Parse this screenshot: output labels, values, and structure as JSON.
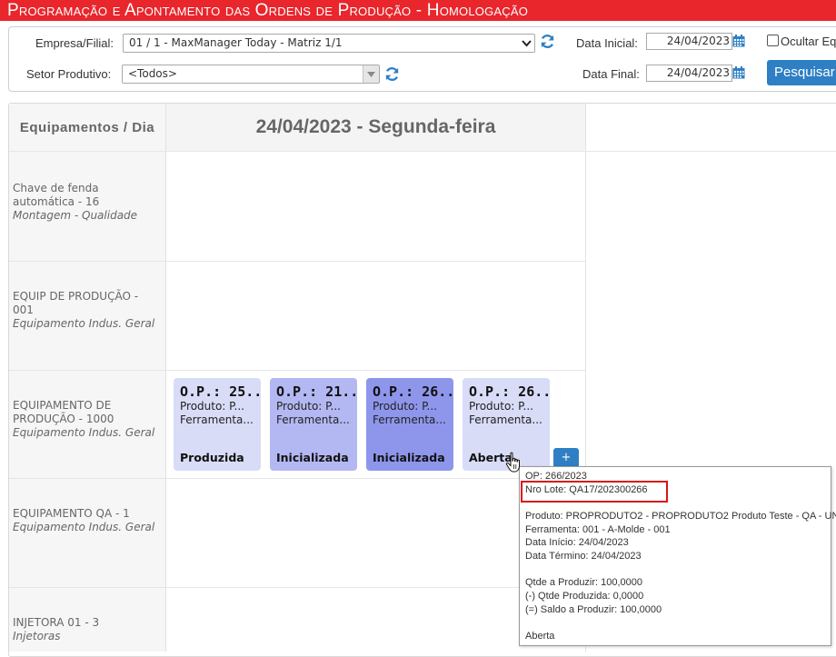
{
  "app": {
    "title": "Programação e Apontamento das Ordens de Produção  - Homologação"
  },
  "filters": {
    "empresa_label": "Empresa/Filial:",
    "empresa_value": "01 / 1 - MaxManager Today - Matriz 1/1",
    "setor_label": "Setor Produtivo:",
    "setor_value": "<Todos>",
    "data_inicial_label": "Data Inicial:",
    "data_inicial_value": "24/04/2023",
    "data_final_label": "Data Final:",
    "data_final_value": "24/04/2023",
    "ocultar_label": "Ocultar Eq",
    "pesquisar_label": "Pesquisar"
  },
  "grid": {
    "header_left": "Equipamentos / Dia",
    "header_day": "24/04/2023 - Segunda-feira",
    "equipment": [
      {
        "name": "Chave de fenda automática - 16",
        "group": "Montagem - Qualidade"
      },
      {
        "name": "EQUIP DE PRODUÇÃO - 001",
        "group": "Equipamento Indus. Geral"
      },
      {
        "name": "EQUIPAMENTO DE PRODUÇÃO - 1000",
        "group": "Equipamento Indus. Geral"
      },
      {
        "name": "EQUIPAMENTO QA - 1",
        "group": "Equipamento Indus. Geral"
      },
      {
        "name": "INJETORA 01 - 3",
        "group": "Injetoras"
      }
    ],
    "cards": [
      {
        "op": "O.P.: 25...",
        "produto": "Produto: P...",
        "ferramenta": "Ferramenta...",
        "status": "Produzida",
        "color": "#d9dcf7"
      },
      {
        "op": "O.P.: 21...",
        "produto": "Produto: P...",
        "ferramenta": "Ferramenta...",
        "status": "Inicializada",
        "color": "#b3b8f2"
      },
      {
        "op": "O.P.: 26...",
        "produto": "Produto: P...",
        "ferramenta": "Ferramenta...",
        "status": "Inicializada",
        "color": "#8e96ec"
      },
      {
        "op": "O.P.: 26...",
        "produto": "Produto: P...",
        "ferramenta": "Ferramenta...",
        "status": "Aberta",
        "color": "#d9dcf7"
      }
    ],
    "add_label": "+"
  },
  "tooltip": {
    "op": "OP: 266/2023",
    "lote": "Nro Lote: QA17/202300266",
    "produto": "Produto: PROPRODUTO2 - PROPRODUTO2 Produto Teste - QA - UN",
    "ferramenta": "Ferramenta: 001 - A-Molde - 001",
    "data_inicio": "Data Início: 24/04/2023",
    "data_termino": "Data Término: 24/04/2023",
    "qtde_produzir": "Qtde a Produzir: 100,0000",
    "qtde_produzida": "(-) Qtde Produzida: 0,0000",
    "saldo": "(=) Saldo a Produzir: 100,0000",
    "status": "Aberta"
  },
  "colors": {
    "title_bar": "#e8262c",
    "accent": "#2e7fc4",
    "highlight_border": "#d9141a"
  },
  "icons": {
    "refresh": "refresh-icon",
    "calendar": "calendar-icon",
    "cursor": "hand-cursor-icon"
  }
}
